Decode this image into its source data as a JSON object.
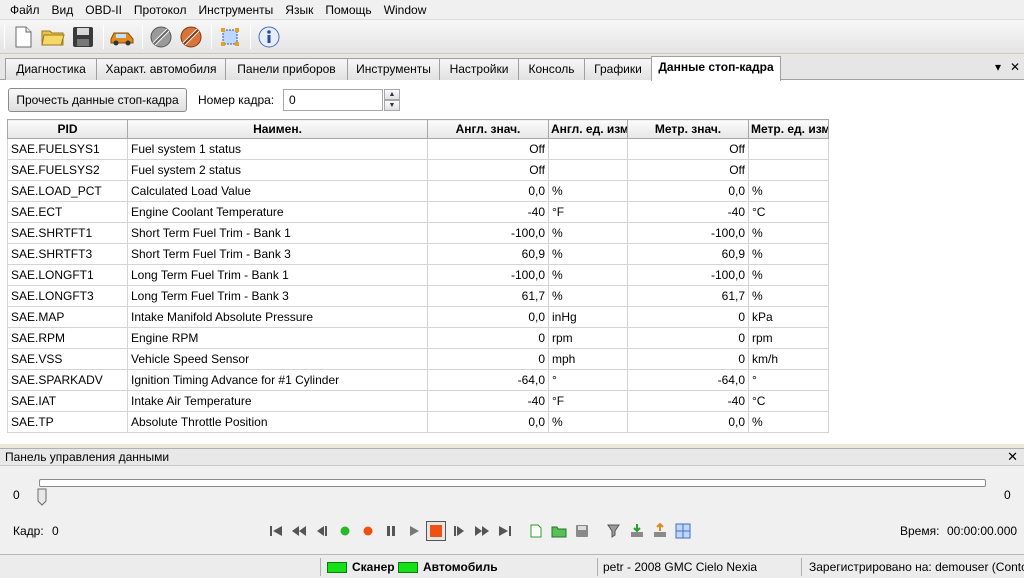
{
  "menu": [
    "Файл",
    "Вид",
    "OBD-II",
    "Протокол",
    "Инструменты",
    "Язык",
    "Помощь",
    "Window"
  ],
  "toolbar": {
    "icons": [
      "new-file-icon",
      "open-folder-icon",
      "save-disk-icon",
      "car-icon",
      "connect-plug-icon",
      "disconnect-plug-icon",
      "select-frame-icon",
      "info-icon"
    ]
  },
  "tabs": [
    {
      "label": "Диагностика"
    },
    {
      "label": "Характ. автомобиля"
    },
    {
      "label": "Панели приборов"
    },
    {
      "label": "Инструменты"
    },
    {
      "label": "Настройки"
    },
    {
      "label": "Консоль"
    },
    {
      "label": "Графики"
    },
    {
      "label": "Данные стоп-кадра",
      "active": true
    }
  ],
  "tab_controls": {
    "menu": "▾",
    "close": "✕"
  },
  "freeze": {
    "read_button": "Прочесть данные стоп-кадра",
    "frame_label": "Номер кадра:",
    "frame_value": "0",
    "spin_up": "▲",
    "spin_down": "▼"
  },
  "table": {
    "columns": [
      "PID",
      "Наимен.",
      "Англ. знач.",
      "Англ. ед. изм.",
      "Метр. знач.",
      "Метр. ед. изм"
    ],
    "rows": [
      [
        "SAE.FUELSYS1",
        "Fuel system 1 status",
        "Off",
        "",
        "Off",
        ""
      ],
      [
        "SAE.FUELSYS2",
        "Fuel system 2 status",
        "Off",
        "",
        "Off",
        ""
      ],
      [
        "SAE.LOAD_PCT",
        "Calculated Load Value",
        "0,0",
        "%",
        "0,0",
        "%"
      ],
      [
        "SAE.ECT",
        "Engine Coolant Temperature",
        "-40",
        "°F",
        "-40",
        "°C"
      ],
      [
        "SAE.SHRTFT1",
        "Short Term Fuel Trim - Bank 1",
        "-100,0",
        "%",
        "-100,0",
        "%"
      ],
      [
        "SAE.SHRTFT3",
        "Short Term Fuel Trim - Bank 3",
        "60,9",
        "%",
        "60,9",
        "%"
      ],
      [
        "SAE.LONGFT1",
        "Long Term Fuel Trim - Bank 1",
        "-100,0",
        "%",
        "-100,0",
        "%"
      ],
      [
        "SAE.LONGFT3",
        "Long Term Fuel Trim - Bank 3",
        "61,7",
        "%",
        "61,7",
        "%"
      ],
      [
        "SAE.MAP",
        "Intake Manifold Absolute Pressure",
        "0,0",
        "inHg",
        "0",
        "kPa"
      ],
      [
        "SAE.RPM",
        "Engine RPM",
        "0",
        "rpm",
        "0",
        "rpm"
      ],
      [
        "SAE.VSS",
        "Vehicle Speed Sensor",
        "0",
        "mph",
        "0",
        "km/h"
      ],
      [
        "SAE.SPARKADV",
        "Ignition Timing Advance for #1 Cylinder",
        "-64,0",
        "°",
        "-64,0",
        "°"
      ],
      [
        "SAE.IAT",
        "Intake Air Temperature",
        "-40",
        "°F",
        "-40",
        "°C"
      ],
      [
        "SAE.TP",
        "Absolute Throttle Position",
        "0,0",
        "%",
        "0,0",
        "%"
      ]
    ]
  },
  "data_panel": {
    "title": "Панель управления данными",
    "close": "✕",
    "slider_min": "0",
    "slider_max": "0",
    "slider_position": 0,
    "frame_label": "Кадр:",
    "frame_value": "0",
    "time_label": "Время:",
    "time_value": "00:00:00.000",
    "playback_icons": [
      "skip-to-start-icon",
      "rewind-icon",
      "step-back-icon",
      "play-green-icon",
      "record-icon",
      "pause-icon",
      "stop-icon",
      "step-forward-icon",
      "fast-forward-icon",
      "skip-to-end-icon",
      "new-log-icon",
      "open-log-icon",
      "save-log-icon",
      "filter-icon",
      "import-icon",
      "export-icon",
      "settings-grid-icon"
    ]
  },
  "status": {
    "scanner": "Сканер",
    "vehicle": "Автомобиль",
    "vehicle_info": "petr - 2008 GMC Cielo Nexia",
    "registered": "Зарегистрировано на: demouser (Contoso)",
    "led_color": "#18e018"
  }
}
